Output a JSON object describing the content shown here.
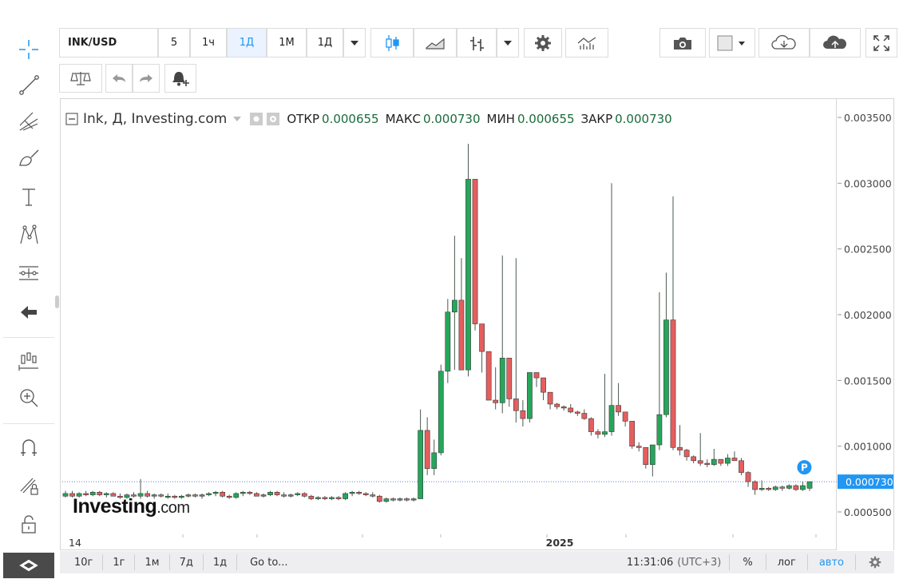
{
  "toolbar": {
    "symbol": "INK/USD",
    "intervals": [
      "5",
      "1ч",
      "1Д",
      "1М",
      "1Д"
    ],
    "active_interval_index": 2
  },
  "legend": {
    "title": "Ink, Д, Investing.com",
    "open_label": "ОТКР",
    "open_value": "0.000655",
    "high_label": "МАКС",
    "high_value": "0.000730",
    "low_label": "МИН",
    "low_value": "0.000655",
    "close_label": "ЗАКР",
    "close_value": "0.000730"
  },
  "watermark": {
    "brand": "Investing",
    "suffix": ".com"
  },
  "price_marker": {
    "value": "0.000730",
    "badge": "P",
    "color": "#2196f3"
  },
  "bottom_bar": {
    "ranges": [
      "10г",
      "1г",
      "1м",
      "7д",
      "1д"
    ],
    "goto": "Go to...",
    "time": "11:31:06",
    "timezone": "(UTC+3)",
    "percent": "%",
    "log": "лог",
    "auto": "авто"
  },
  "colors": {
    "up": "#26a65b",
    "down": "#e55e5e",
    "accent": "#2196f3"
  },
  "chart_data": {
    "type": "candlestick",
    "y_ticks": [
      "0.003500",
      "0.003000",
      "0.002500",
      "0.002000",
      "0.001500",
      "0.001000",
      "0.000500"
    ],
    "y_tick_values": [
      0.0035,
      0.003,
      0.0025,
      0.002,
      0.0015,
      0.001,
      0.0005
    ],
    "ylim": [
      0.00033,
      0.00364
    ],
    "x_ticks": [
      {
        "label": "14",
        "index": 0
      },
      {
        "label": "2025",
        "index": 72
      }
    ],
    "last_price": 0.00073,
    "candles": [
      [
        0.00062,
        0.00066,
        0.00061,
        0.00064
      ],
      [
        0.00064,
        0.00066,
        0.00061,
        0.00062
      ],
      [
        0.00062,
        0.00065,
        0.00061,
        0.00064
      ],
      [
        0.00064,
        0.00066,
        0.00062,
        0.00063
      ],
      [
        0.00063,
        0.00066,
        0.00062,
        0.00065
      ],
      [
        0.00065,
        0.00066,
        0.00062,
        0.00063
      ],
      [
        0.00063,
        0.00065,
        0.00061,
        0.00064
      ],
      [
        0.00064,
        0.00065,
        0.00062,
        0.00062
      ],
      [
        0.00062,
        0.00064,
        0.0006,
        0.00061
      ],
      [
        0.00061,
        0.00064,
        0.0006,
        0.00063
      ],
      [
        0.00063,
        0.00065,
        0.00061,
        0.00062
      ],
      [
        0.00062,
        0.00075,
        0.0006,
        0.00064
      ],
      [
        0.00064,
        0.00066,
        0.00061,
        0.00062
      ],
      [
        0.00062,
        0.00064,
        0.0006,
        0.00063
      ],
      [
        0.00063,
        0.00064,
        0.00061,
        0.00062
      ],
      [
        0.00062,
        0.00064,
        0.0006,
        0.00062
      ],
      [
        0.00062,
        0.00063,
        0.0006,
        0.00061
      ],
      [
        0.00061,
        0.00063,
        0.0006,
        0.00062
      ],
      [
        0.00062,
        0.00064,
        0.00061,
        0.00063
      ],
      [
        0.00063,
        0.00064,
        0.00061,
        0.00062
      ],
      [
        0.00062,
        0.00064,
        0.0006,
        0.00063
      ],
      [
        0.00063,
        0.00065,
        0.00062,
        0.00064
      ],
      [
        0.00064,
        0.00066,
        0.00062,
        0.00065
      ],
      [
        0.00065,
        0.00066,
        0.00061,
        0.00062
      ],
      [
        0.00062,
        0.00063,
        0.0006,
        0.00061
      ],
      [
        0.00061,
        0.00065,
        0.0006,
        0.00064
      ],
      [
        0.00064,
        0.00066,
        0.00062,
        0.00065
      ],
      [
        0.00065,
        0.00066,
        0.00063,
        0.00064
      ],
      [
        0.00064,
        0.00065,
        0.00062,
        0.00062
      ],
      [
        0.00062,
        0.00064,
        0.00061,
        0.00063
      ],
      [
        0.00063,
        0.00066,
        0.00062,
        0.00065
      ],
      [
        0.00065,
        0.00066,
        0.00062,
        0.00063
      ],
      [
        0.00063,
        0.00065,
        0.00061,
        0.00062
      ],
      [
        0.00062,
        0.00064,
        0.00061,
        0.00063
      ],
      [
        0.00063,
        0.00065,
        0.00062,
        0.00064
      ],
      [
        0.00064,
        0.00065,
        0.00061,
        0.00062
      ],
      [
        0.00062,
        0.00063,
        0.00059,
        0.0006
      ],
      [
        0.0006,
        0.00062,
        0.00059,
        0.00061
      ],
      [
        0.00061,
        0.00062,
        0.00059,
        0.0006
      ],
      [
        0.0006,
        0.00062,
        0.00059,
        0.00061
      ],
      [
        0.00061,
        0.00062,
        0.00059,
        0.0006
      ],
      [
        0.0006,
        0.00065,
        0.00059,
        0.00064
      ],
      [
        0.00064,
        0.00066,
        0.00062,
        0.00065
      ],
      [
        0.00065,
        0.00066,
        0.00063,
        0.00064
      ],
      [
        0.00064,
        0.00065,
        0.00062,
        0.00063
      ],
      [
        0.00063,
        0.00065,
        0.00061,
        0.00062
      ],
      [
        0.00062,
        0.00063,
        0.00057,
        0.00058
      ],
      [
        0.00058,
        0.00061,
        0.00057,
        0.0006
      ],
      [
        0.0006,
        0.00061,
        0.00058,
        0.00059
      ],
      [
        0.00059,
        0.00061,
        0.00058,
        0.0006
      ],
      [
        0.0006,
        0.00061,
        0.00058,
        0.00059
      ],
      [
        0.00059,
        0.00061,
        0.00058,
        0.0006
      ],
      [
        0.0006,
        0.00128,
        0.0006,
        0.00112
      ],
      [
        0.00112,
        0.00122,
        0.00078,
        0.00083
      ],
      [
        0.00083,
        0.00105,
        0.00078,
        0.00095
      ],
      [
        0.00095,
        0.00162,
        0.00093,
        0.00157
      ],
      [
        0.00157,
        0.00212,
        0.00148,
        0.00202
      ],
      [
        0.00202,
        0.0026,
        0.00158,
        0.00211
      ],
      [
        0.00211,
        0.00243,
        0.00165,
        0.00158
      ],
      [
        0.00158,
        0.0033,
        0.00153,
        0.00303
      ],
      [
        0.00303,
        0.00302,
        0.00188,
        0.00193
      ],
      [
        0.00193,
        0.00182,
        0.00156,
        0.00172
      ],
      [
        0.00172,
        0.0016,
        0.0014,
        0.00135
      ],
      [
        0.00135,
        0.0016,
        0.00128,
        0.00133
      ],
      [
        0.00133,
        0.00245,
        0.00125,
        0.00167
      ],
      [
        0.00167,
        0.0016,
        0.0013,
        0.00136
      ],
      [
        0.00136,
        0.00243,
        0.00118,
        0.00127
      ],
      [
        0.00127,
        0.00135,
        0.00115,
        0.00121
      ],
      [
        0.00121,
        0.00145,
        0.00118,
        0.00156
      ],
      [
        0.00156,
        0.00155,
        0.00145,
        0.00152
      ],
      [
        0.00152,
        0.00148,
        0.00135,
        0.00141
      ],
      [
        0.00141,
        0.00135,
        0.00128,
        0.00132
      ],
      [
        0.00132,
        0.00133,
        0.00128,
        0.0013
      ],
      [
        0.0013,
        0.00131,
        0.00127,
        0.00129
      ],
      [
        0.00129,
        0.00132,
        0.00125,
        0.00126
      ],
      [
        0.00126,
        0.00127,
        0.00123,
        0.00125
      ],
      [
        0.00125,
        0.00128,
        0.0012,
        0.00121
      ],
      [
        0.00121,
        0.00122,
        0.00108,
        0.00111
      ],
      [
        0.00111,
        0.00113,
        0.00106,
        0.00109
      ],
      [
        0.00109,
        0.00155,
        0.00107,
        0.00111
      ],
      [
        0.00111,
        0.003,
        0.00108,
        0.00131
      ],
      [
        0.00131,
        0.00148,
        0.00123,
        0.00126
      ],
      [
        0.00126,
        0.0012,
        0.00115,
        0.00119
      ],
      [
        0.00119,
        0.00119,
        0.00098,
        0.001
      ],
      [
        0.001,
        0.00103,
        0.00096,
        0.00099
      ],
      [
        0.00099,
        0.00097,
        0.00083,
        0.00086
      ],
      [
        0.00086,
        0.00091,
        0.00077,
        0.00101
      ],
      [
        0.00101,
        0.00217,
        0.00097,
        0.00124
      ],
      [
        0.00124,
        0.00232,
        0.00122,
        0.00196
      ],
      [
        0.00196,
        0.0029,
        0.00097,
        0.00099
      ],
      [
        0.00099,
        0.00116,
        0.00093,
        0.00097
      ],
      [
        0.00097,
        0.00098,
        0.00089,
        0.00092
      ],
      [
        0.00092,
        0.00093,
        0.00087,
        0.00089
      ],
      [
        0.00089,
        0.0011,
        0.00085,
        0.00087
      ],
      [
        0.00087,
        0.0009,
        0.00084,
        0.00086
      ],
      [
        0.00086,
        0.00098,
        0.00085,
        0.0009
      ],
      [
        0.0009,
        0.00089,
        0.00085,
        0.00087
      ],
      [
        0.00087,
        0.00094,
        0.00085,
        0.00091
      ],
      [
        0.00091,
        0.00096,
        0.00089,
        0.00089
      ],
      [
        0.00089,
        0.00091,
        0.00078,
        0.0008
      ],
      [
        0.0008,
        0.00081,
        0.00069,
        0.00073
      ],
      [
        0.00073,
        0.00074,
        0.00063,
        0.00067
      ],
      [
        0.00067,
        0.00074,
        0.00066,
        0.00068
      ],
      [
        0.00068,
        0.00069,
        0.00066,
        0.00067
      ],
      [
        0.00067,
        0.0007,
        0.00066,
        0.00069
      ],
      [
        0.00069,
        0.0007,
        0.00066,
        0.00068
      ],
      [
        0.00068,
        0.00071,
        0.00067,
        0.0007
      ],
      [
        0.0007,
        0.00071,
        0.00066,
        0.00067
      ],
      [
        0.00067,
        0.00073,
        0.00066,
        0.0007
      ],
      [
        0.00068,
        0.00073,
        0.00066,
        0.00073
      ]
    ]
  }
}
